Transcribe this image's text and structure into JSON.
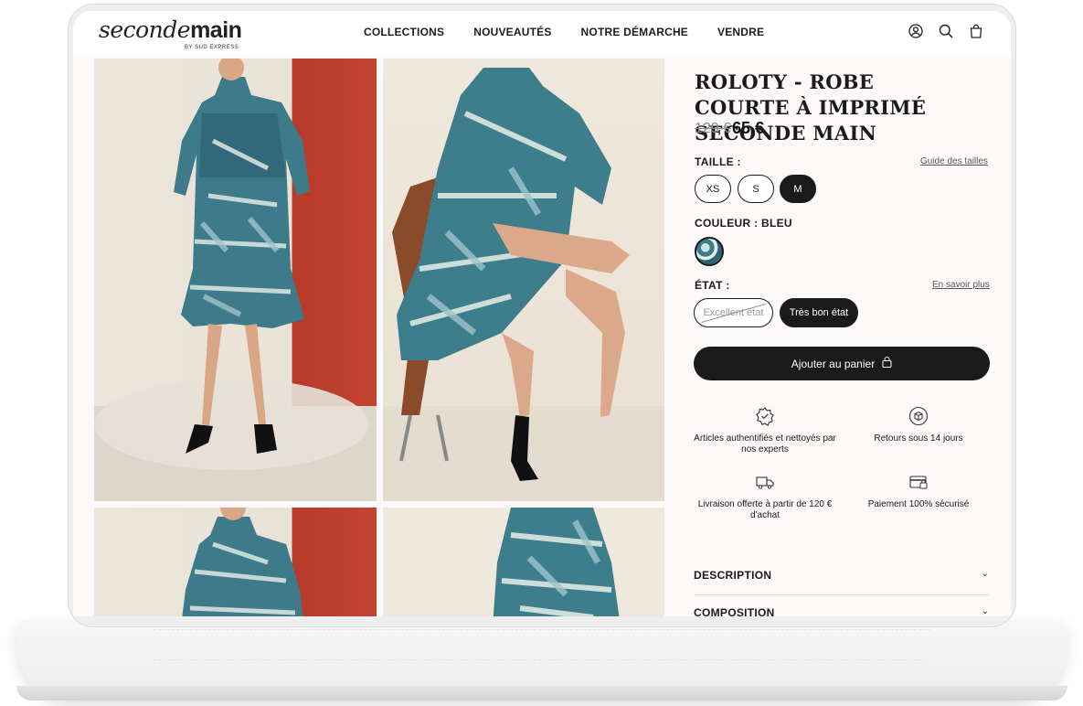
{
  "brand": {
    "name_light": "seconde",
    "name_bold": "main",
    "tagline": "BY SUD EXPRESS"
  },
  "nav": [
    "COLLECTIONS",
    "NOUVEAUTÉS",
    "NOTRE DÉMARCHE",
    "VENDRE"
  ],
  "header_icons": [
    "account-icon",
    "search-icon",
    "bag-icon"
  ],
  "product": {
    "title": "ROLOTY - ROBE COURTE À IMPRIMÉ SECONDE MAIN",
    "price_old": "129 €",
    "price_new": "65 €",
    "size_label": "TAILLE :",
    "size_guide": "Guide des tailles",
    "sizes": [
      "XS",
      "S",
      "M"
    ],
    "selected_size": "M",
    "color_label": "COULEUR : BLEU",
    "state_label": "ÉTAT :",
    "state_more": "En savoir plus",
    "states": [
      "Excellent état",
      "Très bon état"
    ],
    "selected_state": "Très bon état",
    "cart_label": "Ajouter au panier"
  },
  "features": [
    {
      "icon": "star-badge-icon",
      "text": "Articles authentifiés et nettoyés par nos experts"
    },
    {
      "icon": "return-box-icon",
      "text": "Retours sous 14 jours"
    },
    {
      "icon": "delivery-truck-icon",
      "text": "Livraison offerte à partir de 120 € d'achat"
    },
    {
      "icon": "secure-card-icon",
      "text": "Paiement 100% sécurisé"
    }
  ],
  "accordions": [
    "DESCRIPTION",
    "COMPOSITION"
  ]
}
